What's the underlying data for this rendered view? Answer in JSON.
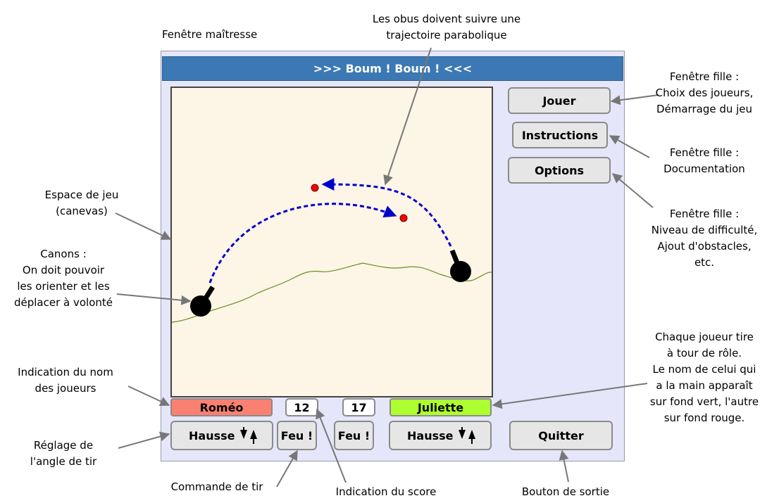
{
  "window": {
    "title": ">>> Boum ! Boum ! <<<"
  },
  "buttons": {
    "play": "Jouer",
    "instructions": "Instructions",
    "options": "Options",
    "quit": "Quitter",
    "fire_left": "Feu !",
    "fire_right": "Feu !",
    "hausse_left": "Hausse",
    "hausse_right": "Hausse"
  },
  "players": {
    "left_name": "Roméo",
    "right_name": "Juliette",
    "left_score": "12",
    "right_score": "17"
  },
  "colors": {
    "title_bar": "#3c79b4",
    "master_bg": "#e6e6fa",
    "canvas_bg": "#fdf5e6",
    "player_active": "#adff2f",
    "player_inactive": "#fa8072",
    "trajectory": "#0000cc",
    "shell": "#ff0000",
    "terrain": "#6b8e23"
  },
  "annotations": {
    "master_window": "Fenêtre maîtresse",
    "trajectory": [
      "Les obus doivent suivre une",
      "trajectoire parabolique"
    ],
    "child_play": [
      "Fenêtre fille :",
      "Choix des joueurs,",
      "Démarrage du jeu"
    ],
    "child_doc": [
      "Fenêtre fille :",
      "Documentation"
    ],
    "child_options": [
      "Fenêtre fille :",
      "Niveau de difficulté,",
      "Ajout d'obstacles,",
      "etc."
    ],
    "canvas": [
      "Espace de jeu",
      "(canevas)"
    ],
    "cannons": [
      "Canons :",
      "On doit pouvoir",
      "les orienter et les",
      "déplacer à volonté"
    ],
    "turns": [
      "Chaque joueur tire",
      "à tour de rôle.",
      "Le nom de celui qui",
      "a la main apparaît",
      "sur fond vert, l'autre",
      "sur fond rouge."
    ],
    "player_names": [
      "Indication du nom",
      "des joueurs"
    ],
    "angle": [
      "Réglage de",
      "l'angle de tir"
    ],
    "fire_cmd": "Commande de tir",
    "score": "Indication du score",
    "exit": "Bouton de sortie"
  }
}
